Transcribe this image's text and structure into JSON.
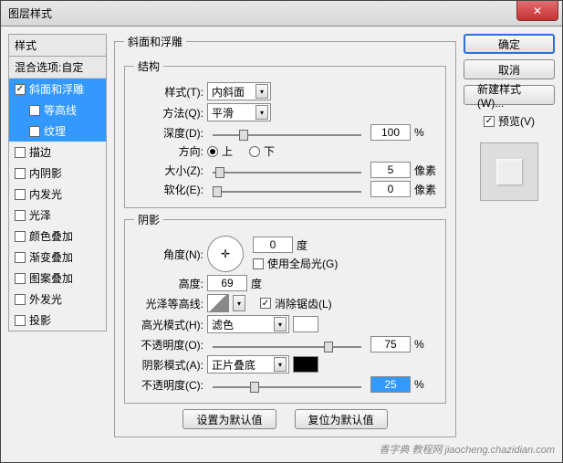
{
  "window": {
    "title": "图层样式"
  },
  "buttons": {
    "ok": "确定",
    "cancel": "取消",
    "new_style": "新建样式(W)...",
    "preview": "预览(V)",
    "set_default": "设置为默认值",
    "reset_default": "复位为默认值"
  },
  "left": {
    "header": "样式",
    "blend": "混合选项:自定",
    "items": [
      {
        "key": "bevel",
        "label": "斜面和浮雕",
        "checked": true,
        "selected": true
      },
      {
        "key": "contour",
        "label": "等高线",
        "checked": false,
        "sub": true,
        "selected": true
      },
      {
        "key": "texture",
        "label": "纹理",
        "checked": false,
        "sub": true,
        "selected": true
      },
      {
        "key": "stroke",
        "label": "描边",
        "checked": false
      },
      {
        "key": "inner_shadow",
        "label": "内阴影",
        "checked": false
      },
      {
        "key": "inner_glow",
        "label": "内发光",
        "checked": false
      },
      {
        "key": "satin",
        "label": "光泽",
        "checked": false
      },
      {
        "key": "color_overlay",
        "label": "颜色叠加",
        "checked": false
      },
      {
        "key": "grad_overlay",
        "label": "渐变叠加",
        "checked": false
      },
      {
        "key": "pat_overlay",
        "label": "图案叠加",
        "checked": false
      },
      {
        "key": "outer_glow",
        "label": "外发光",
        "checked": false
      },
      {
        "key": "drop_shadow",
        "label": "投影",
        "checked": false
      }
    ]
  },
  "main": {
    "title": "斜面和浮雕",
    "structure": {
      "legend": "结构",
      "style_label": "样式(T):",
      "style_value": "内斜面",
      "method_label": "方法(Q):",
      "method_value": "平滑",
      "depth_label": "深度(D):",
      "depth_value": "100",
      "percent": "%",
      "direction_label": "方向:",
      "up": "上",
      "down": "下",
      "size_label": "大小(Z):",
      "size_value": "5",
      "px": "像素",
      "soften_label": "软化(E):",
      "soften_value": "0"
    },
    "shading": {
      "legend": "阴影",
      "angle_label": "角度(N):",
      "angle_value": "0",
      "deg": "度",
      "global_label": "使用全局光(G)",
      "altitude_label": "高度:",
      "altitude_value": "69",
      "gloss_label": "光泽等高线:",
      "antialias_label": "消除锯齿(L)",
      "highlight_mode_label": "高光模式(H):",
      "highlight_mode_value": "滤色",
      "highlight_color": "#ffffff",
      "opacity_label": "不透明度(O):",
      "highlight_opacity": "75",
      "shadow_mode_label": "阴影模式(A):",
      "shadow_mode_value": "正片叠底",
      "shadow_color": "#000000",
      "shadow_opacity_label": "不透明度(C):",
      "shadow_opacity": "25"
    }
  },
  "watermark": "香字典  教程网 jiaocheng.chazidian.com"
}
